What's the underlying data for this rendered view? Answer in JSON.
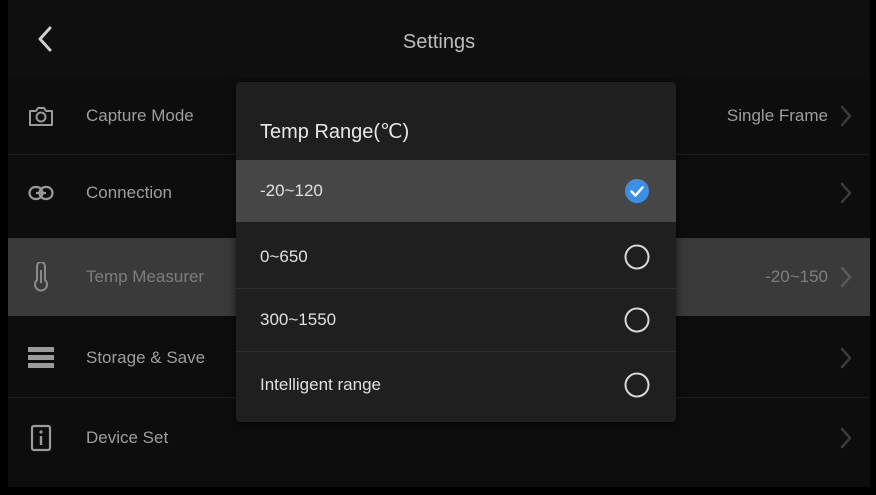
{
  "header": {
    "title": "Settings",
    "back_icon": "chevron-left-icon"
  },
  "rows": [
    {
      "label": "Capture Mode",
      "value": "Single Frame",
      "icon": "camera-icon"
    },
    {
      "label": "Connection",
      "value": "",
      "icon": "link-icon"
    },
    {
      "label": "Temp Measurer",
      "value": "-20~150",
      "icon": "thermometer-icon"
    },
    {
      "label": "Storage & Save",
      "value": "",
      "icon": "storage-icon"
    },
    {
      "label": "Device Set",
      "value": "",
      "icon": "device-icon"
    }
  ],
  "dialog": {
    "title": "Temp Range(℃)",
    "options": [
      {
        "label": "-20~120",
        "selected": true
      },
      {
        "label": "0~650",
        "selected": false
      },
      {
        "label": "300~1550",
        "selected": false
      },
      {
        "label": "Intelligent range",
        "selected": false
      }
    ]
  },
  "colors": {
    "accent": "#3d8fe6",
    "background": "#0d0d0d",
    "dialog": "#1f1f1f",
    "selected_row": "#464646"
  }
}
